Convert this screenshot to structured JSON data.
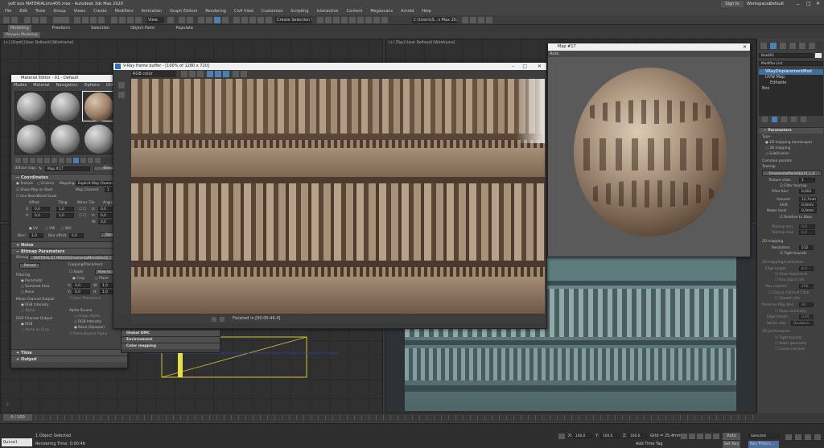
{
  "app": {
    "title": "yoft box MATERIAL\\ms405.max - Autodesk 3ds Max 2020",
    "signin": "Sign In",
    "workspaces_label": "Workspaces:",
    "workspace": "Default"
  },
  "menu": [
    "File",
    "Edit",
    "Tools",
    "Group",
    "Views",
    "Create",
    "Modifiers",
    "Animation",
    "Graph Editors",
    "Rendering",
    "Civil View",
    "Customize",
    "Scripting",
    "Interactive",
    "Content",
    "Megascans",
    "Arnold",
    "Help"
  ],
  "toolbar": {
    "view_dropdown": "View",
    "selection_set": "Create Selection Se",
    "path": "C:\\Users\\S...s Max 2020"
  },
  "ribbon": {
    "tabs": [
      "Modeling",
      "Freeform",
      "Selection",
      "Object Paint",
      "Populate"
    ],
    "sub": "Polygon Modeling"
  },
  "viewports": {
    "top_left": "[+] [Front] [User Defined] [Wireframe]",
    "top_right": "[+] [Top] [User Defined] [Wireframe]"
  },
  "material_editor": {
    "title": "Material Editor - 01 - Default",
    "menu": [
      "Modes",
      "Material",
      "Navigation",
      "Options",
      "Utilities"
    ],
    "map_row": {
      "slot_label": "Diffuse map:",
      "map_name": "Map #17",
      "type": "Bitmap"
    },
    "coordinates": {
      "header": "Coordinates",
      "texture": "Texture",
      "environ": "Environ",
      "mapping_label": "Mapping:",
      "mapping": "Explicit Map Channel",
      "map_channel_label": "Map Channel:",
      "map_channel": "1",
      "show_map_back": "Show Map on Back",
      "real_world": "Use Real-World Scale",
      "col_headers": [
        "Offset",
        "Tiling",
        "Mirror Tile",
        "Angle"
      ],
      "u_label": "U:",
      "v_label": "V:",
      "w_label": "W:",
      "u_offset": "0,0",
      "v_offset": "0,0",
      "u_tiling": "1,0",
      "v_tiling": "1,0",
      "u_angle": "0,0",
      "v_angle": "0,0",
      "w_angle": "0,0",
      "uv": "UV",
      "vw": "VW",
      "wu": "WU",
      "blur_label": "Blur:",
      "blur": "1,0",
      "blur_offset_label": "Blur offset:",
      "blur_offset": "0,0",
      "rotate": "Rotate"
    },
    "noise_header": "Noise",
    "bitmap_params": {
      "header": "Bitmap Parameters",
      "bitmap_label": "Bitmap:",
      "bitmap_path": "...\\MATERIALS\\1 MEDOS\\OrnamentalMorishDo10_1_0.jpg",
      "reload": "Reload",
      "cropping_header": "Cropping/Placement",
      "apply": "Apply",
      "view_image": "View Image",
      "crop": "Crop",
      "place": "Place",
      "u": "0,0",
      "w": "1,0",
      "v": "0,0",
      "h": "1,0",
      "jitter": "Jitter Placement",
      "filtering_header": "Filtering",
      "filters": [
        "Pyramidal",
        "Summed Area",
        "None"
      ],
      "mono_header": "Mono Channel Output:",
      "mono": [
        "RGB Intensity",
        "Alpha"
      ],
      "rgb_header": "RGB Channel Output:",
      "rgb": [
        "RGB",
        "Alpha as Gray"
      ],
      "alpha_source_header": "Alpha Source",
      "alpha_sources": [
        "Image Alpha",
        "RGB Intensity",
        "None (Opaque)"
      ],
      "premult": "Premultiplied Alpha"
    },
    "time_header": "Time",
    "output_header": "Output"
  },
  "frame_buffer": {
    "title": "V-Ray frame buffer - [100% of 1280 x 720]",
    "channel": "RGB color",
    "status": "Finished in [00:00:46.4]",
    "lower_rows": [
      "Global DMC",
      "Environment",
      "Color mapping"
    ]
  },
  "map_window": {
    "title": "Map #17",
    "dropdown": "Auto"
  },
  "command_panel": {
    "object_name": "Box001",
    "modifier_list": "Modifier List",
    "stack": [
      "VRayDisplacementMod",
      "UVW Map",
      "Editable",
      "Box"
    ],
    "params_header": "Parameters",
    "type_label": "Type",
    "types": [
      "2D mapping (landscape)",
      "3D mapping",
      "Subdivision"
    ],
    "common_params": "Common params",
    "texmap_label": "Texmap",
    "texmap": "OrnamentalMorishDo10_1_0",
    "texture_chan_label": "Texture chan",
    "texture_chan": "1",
    "filter_texmap": "Filter texmap",
    "filter_blur_label": "Filter blur",
    "filter_blur": "0,001",
    "amount_label": "Amount",
    "amount": "12,7mm",
    "shift_label": "Shift",
    "shift": "0,0mm",
    "water_level_label": "Water level",
    "water_level": "0,0mm",
    "relative_bbox": "Relative to bbox",
    "texmap_min_label": "Texmap min",
    "texmap_min": "0,0",
    "texmap_max_label": "Texmap max",
    "texmap_max": "1,0",
    "mapping_2d": "2D mapping",
    "resolution_label": "Resolution",
    "resolution": "512",
    "tight_bounds": "Tight bounds",
    "mapping_3d": "3D mapping/subdivision",
    "edge_length_label": "Edge length",
    "edge_length": "4,0",
    "view_dependent": "View-dependent",
    "use_object_mtl": "Use object mtl",
    "max_subdivs_label": "Max subdivs",
    "max_subdivs": "256",
    "classic_catmull": "Classic Catmull-Clark",
    "smooth_uvs": "Smooth UVs",
    "preserve_map_bnd_label": "Preserve Map Bnd",
    "preserve_map_bnd": "All",
    "keep_continuity": "Keep continuity",
    "edge_thresh_label": "Edge thresh",
    "edge_thresh": "0,05",
    "vector_disp_label": "Vector disp",
    "vector_disp": "Disabled",
    "performance": "3D performance",
    "perf_items": [
      "Tight bounds",
      "Static geometry",
      "Cache normals"
    ]
  },
  "status": {
    "frame": "0 / 100",
    "script_label": "Quixel Bridg",
    "selected": "1 Object Selected",
    "render_time": "Rendering Time: 0:00:46",
    "x_label": "X:",
    "x": "100,0",
    "y_label": "Y:",
    "y": "100,0",
    "z_label": "Z:",
    "z": "100,0",
    "grid": "Grid = 25,4mm",
    "add_time_tag": "Add Time Tag",
    "auto_key": "Auto Key",
    "selected_dd": "Selected",
    "set_key": "Set Key",
    "key_filters": "Key Filters..."
  },
  "colors": {
    "accent": "#3e8ed8",
    "window_title": "#f0f0f0",
    "panel": "#444444"
  }
}
